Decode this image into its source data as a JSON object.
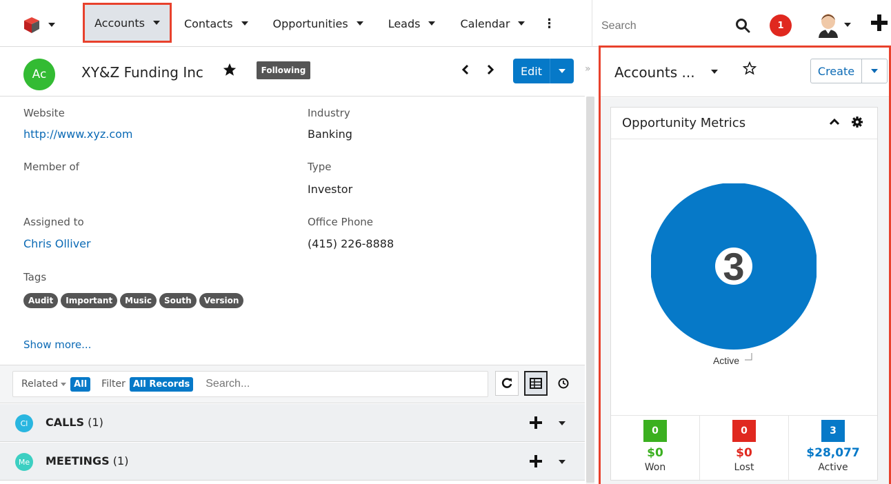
{
  "nav": {
    "items": [
      {
        "label": "Accounts",
        "active": true
      },
      {
        "label": "Contacts",
        "active": false
      },
      {
        "label": "Opportunities",
        "active": false
      },
      {
        "label": "Leads",
        "active": false
      },
      {
        "label": "Calendar",
        "active": false
      }
    ],
    "more_label": "⋮",
    "search_placeholder": "Search",
    "notification_count": "1"
  },
  "record": {
    "avatar_initials": "Ac",
    "name": "XY&Z Funding Inc",
    "follow_label": "Following",
    "edit_label": "Edit",
    "fields": {
      "website_label": "Website",
      "website_value": "http://www.xyz.com",
      "industry_label": "Industry",
      "industry_value": "Banking",
      "member_of_label": "Member of",
      "type_label": "Type",
      "type_value": "Investor",
      "assigned_label": "Assigned to",
      "assigned_value": "Chris Olliver",
      "phone_label": "Office Phone",
      "phone_value": "(415) 226-8888",
      "tags_label": "Tags"
    },
    "tags": [
      "Audit",
      "Important",
      "Music",
      "South",
      "Version"
    ],
    "show_more": "Show more..."
  },
  "related": {
    "related_label": "Related",
    "related_value": "All",
    "filter_label": "Filter",
    "filter_value": "All Records",
    "search_placeholder": "Search..."
  },
  "subpanels": [
    {
      "badge": "Cl",
      "badge_color": "#29b6e0",
      "title": "CALLS",
      "count": "(1)"
    },
    {
      "badge": "Me",
      "badge_color": "#3ccfc2",
      "title": "MEETINGS",
      "count": "(1)"
    }
  ],
  "dashboard": {
    "title": "Accounts ...",
    "create_label": "Create",
    "dashlet_title": "Opportunity Metrics",
    "donut_center": "3",
    "donut_legend": "Active",
    "metrics": [
      {
        "count": "0",
        "amount": "$0",
        "label": "Won",
        "color": "#3bb020"
      },
      {
        "count": "0",
        "amount": "$0",
        "label": "Lost",
        "color": "#e0281f"
      },
      {
        "count": "3",
        "amount": "$28,077",
        "label": "Active",
        "color": "#0679c8"
      }
    ]
  },
  "chart_data": {
    "type": "pie",
    "categories": [
      "Active"
    ],
    "values": [
      3
    ],
    "center_label": "3",
    "colors": [
      "#0679c8"
    ]
  }
}
